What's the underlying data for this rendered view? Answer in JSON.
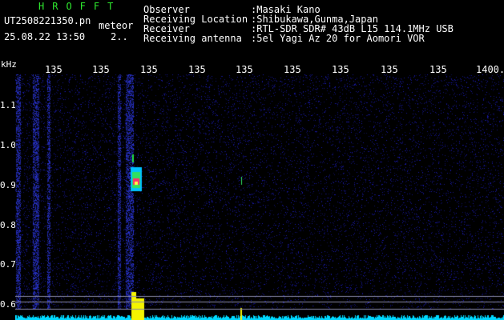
{
  "header": {
    "app_title": "HROFFT",
    "filename": "UT2508221350.pn",
    "label": "meteor",
    "datetime": "25.08.22 13:50",
    "number": "2.."
  },
  "meta": [
    {
      "key": "Observer",
      "value": ":Masaki Kano"
    },
    {
      "key": "Receiving Location",
      "value": ":Shibukawa,Gunma,Japan"
    },
    {
      "key": "Receiver",
      "value": ":RTL-SDR SDR# 43dB L15 114.1MHz USB"
    },
    {
      "key": "Receiving antenna",
      "value": ":5el Yagi Az 20 for Aomori VOR"
    }
  ],
  "axis": {
    "unit": "kHz",
    "x_ticks": [
      "135",
      "135",
      "135",
      "135",
      "135",
      "135",
      "135",
      "135",
      "135",
      "1400."
    ],
    "y_ticks": [
      "1.1",
      "1.0",
      "0.9",
      "0.8",
      "0.7",
      "0.6"
    ]
  },
  "colors": {
    "background": "#000000",
    "noise": "#1a1a8c",
    "title": "#2ee82e",
    "signal_hot": "#ff3070",
    "signal_mid": "#00c0ff",
    "floor": "#00d8ff",
    "burst": "#f4f400"
  }
}
